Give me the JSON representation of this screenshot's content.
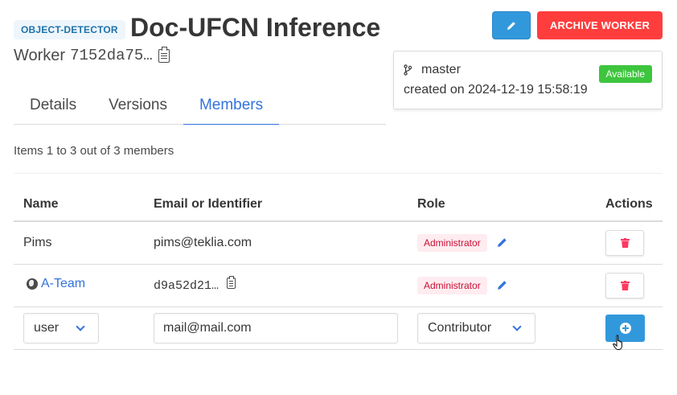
{
  "header": {
    "type_tag": "OBJECT-DETECTOR",
    "title": "Doc-UFCN Inference",
    "worker_label": "Worker",
    "worker_id": "7152da75…",
    "archive_label": "ARCHIVE WORKER"
  },
  "revision": {
    "branch": "master",
    "created": "created on 2024-12-19 15:58:19",
    "status": "Available"
  },
  "tabs": [
    {
      "label": "Details"
    },
    {
      "label": "Versions"
    },
    {
      "label": "Members",
      "active": true
    }
  ],
  "items_count": "Items 1 to 3 out of 3 members",
  "table": {
    "headers": [
      "Name",
      "Email or Identifier",
      "Role",
      "Actions"
    ],
    "rows": [
      {
        "name": "Pims",
        "email": "pims@teklia.com",
        "role": "Administrator"
      },
      {
        "name": "A-Team",
        "email": "d9a52d21…",
        "role": "Administrator"
      }
    ]
  },
  "new_member": {
    "type_value": "user",
    "email_value": "mail@mail.com",
    "role_value": "Contributor"
  },
  "colors": {
    "primary": "#3298dc",
    "danger": "#ff3d3d",
    "success": "#3ec53e",
    "link": "#3273dc"
  },
  "icons": [
    "edit-icon",
    "branch-icon",
    "clipboard-icon",
    "globe-icon",
    "trash-icon",
    "plus-circle-icon",
    "pointer-cursor-icon"
  ]
}
